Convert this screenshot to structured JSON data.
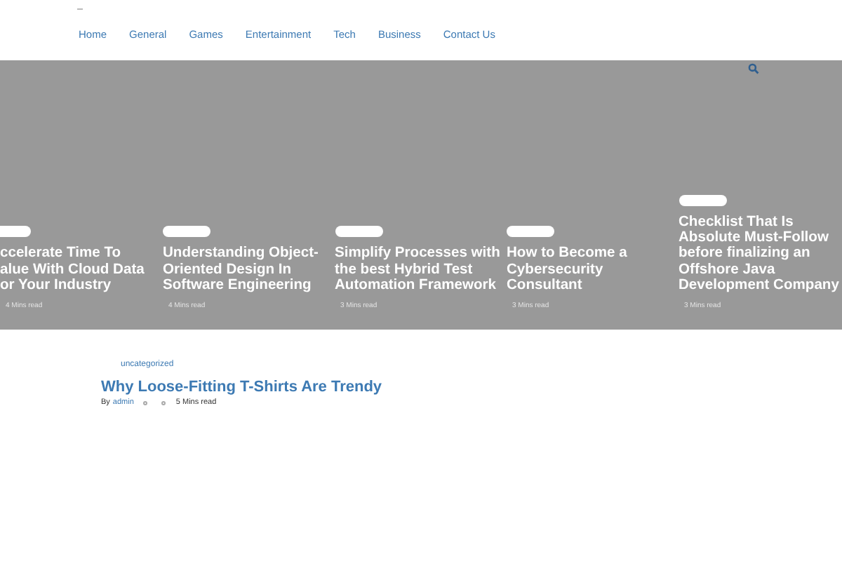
{
  "nav": {
    "items": [
      {
        "label": "Home"
      },
      {
        "label": "General"
      },
      {
        "label": "Games"
      },
      {
        "label": "Entertainment"
      },
      {
        "label": "Tech"
      },
      {
        "label": "Business"
      },
      {
        "label": "Contact Us"
      }
    ]
  },
  "slider": {
    "cards": [
      {
        "title_lines": [
          "ccelerate Time To",
          "alue With Cloud Data",
          "or Your Industry"
        ],
        "read_time": "4 Mins read"
      },
      {
        "title_lines": [
          "Understanding Object-",
          "Oriented Design In",
          "Software Engineering"
        ],
        "read_time": "4 Mins read"
      },
      {
        "title_lines": [
          "Simplify Processes with",
          "the best Hybrid Test",
          "Automation Framework"
        ],
        "read_time": "3 Mins read"
      },
      {
        "title_lines": [
          "How to Become a",
          "Cybersecurity",
          "Consultant"
        ],
        "read_time": "3 Mins read"
      },
      {
        "title_lines": [
          "Checklist That Is",
          "Absolute Must-Follow",
          "before finalizing an",
          "Offshore Java",
          "Development Company"
        ],
        "read_time": "3 Mins read"
      }
    ]
  },
  "post": {
    "category": "uncategorized",
    "title": "Why Loose-Fitting T-Shirts Are Trendy",
    "by": "By",
    "author": "admin",
    "read_time": "5 Mins read"
  }
}
